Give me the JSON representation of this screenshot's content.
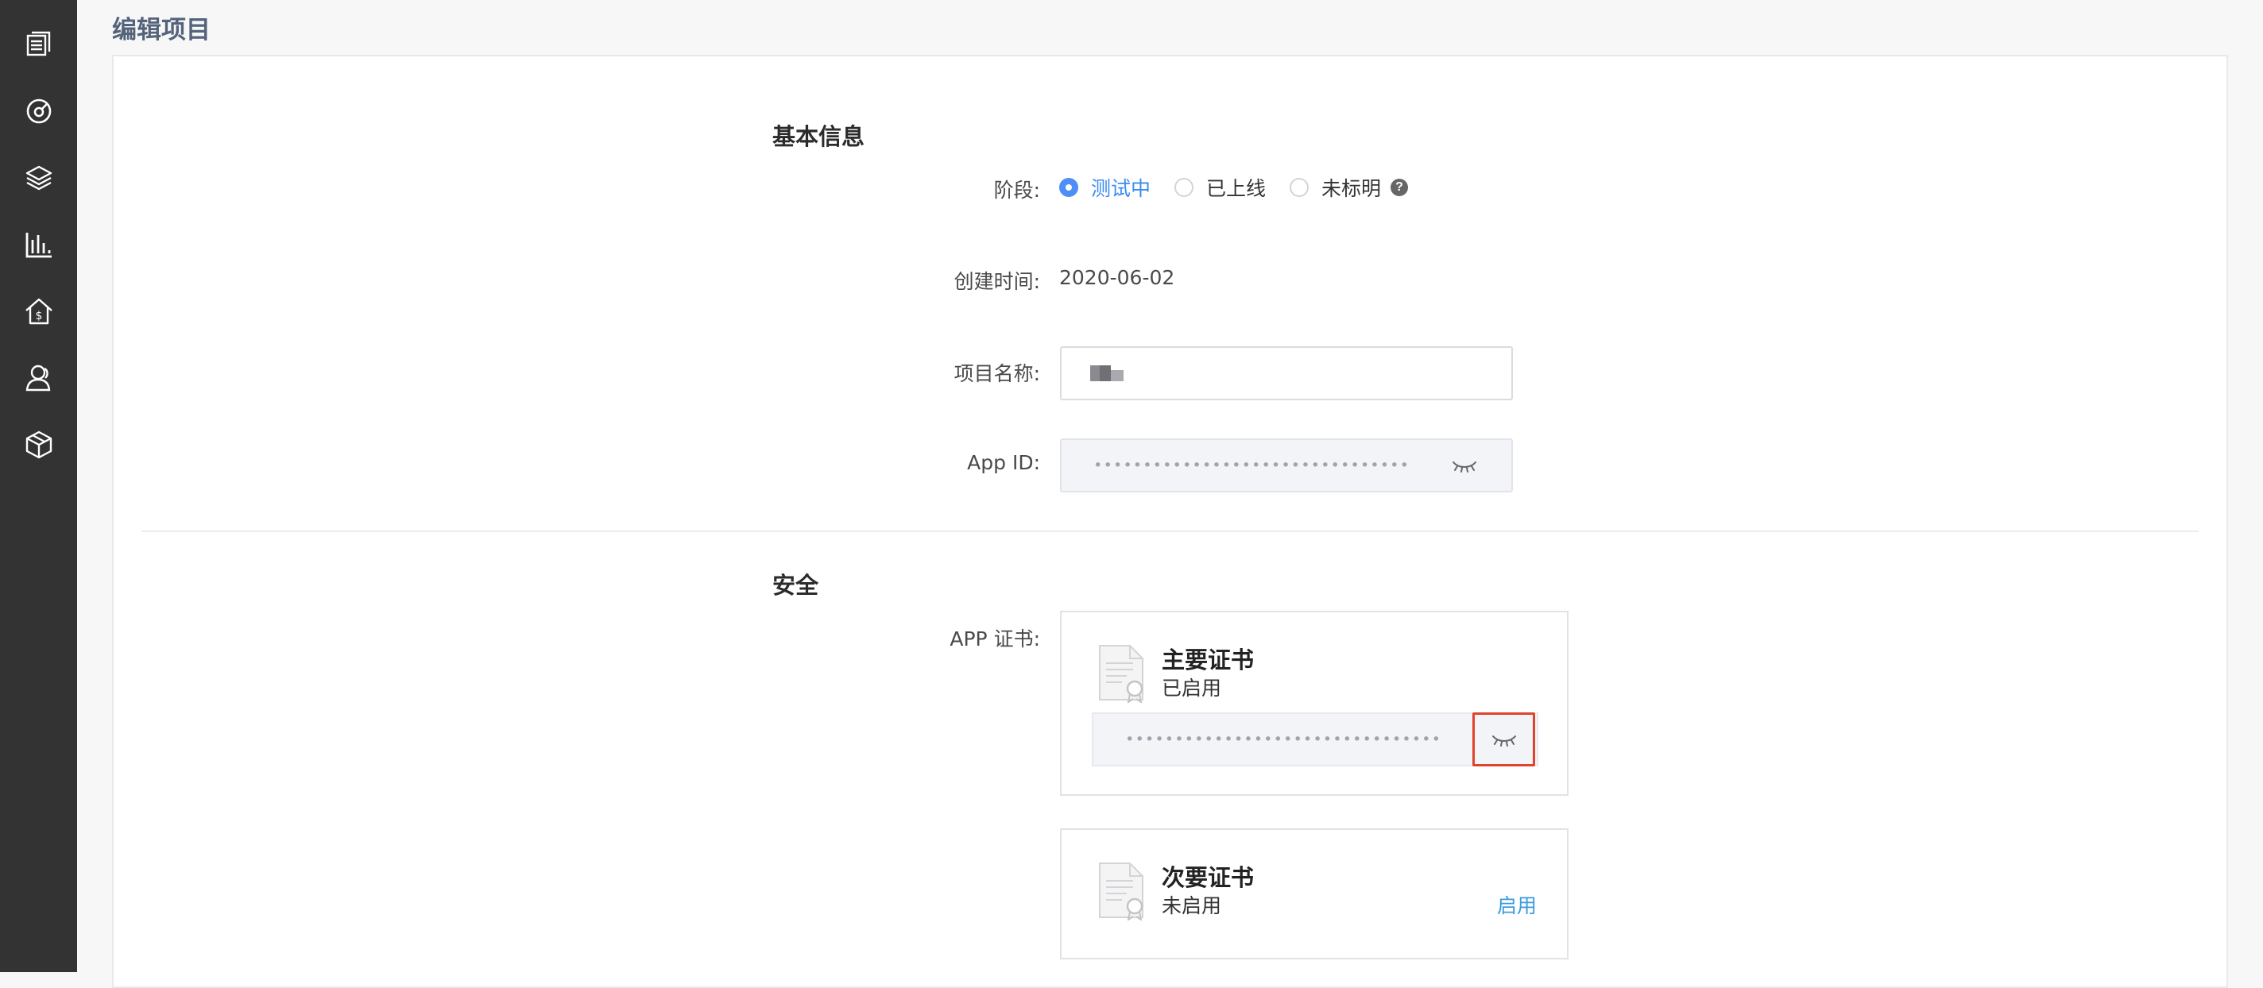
{
  "page": {
    "title": "编辑项目"
  },
  "sidebar": {
    "icons": [
      "documents-icon",
      "dashboard-icon",
      "layers-icon",
      "bar-chart-icon",
      "billing-icon",
      "user-icon",
      "package-icon"
    ]
  },
  "basic": {
    "title": "基本信息",
    "stage": {
      "label": "阶段:",
      "options": [
        {
          "label": "测试中",
          "selected": true
        },
        {
          "label": "已上线",
          "selected": false
        },
        {
          "label": "未标明",
          "selected": false
        }
      ],
      "help": "?"
    },
    "created": {
      "label": "创建时间:",
      "value": "2020-06-02"
    },
    "name": {
      "label": "项目名称:"
    },
    "appid": {
      "label": "App ID:",
      "masked": "••••••••••••••••••••••••••••••••"
    }
  },
  "security": {
    "title": "安全",
    "cert_label": "APP 证书:",
    "primary": {
      "title": "主要证书",
      "status": "已启用",
      "masked": "••••••••••••••••••••••••••••••••"
    },
    "secondary": {
      "title": "次要证书",
      "status": "未启用",
      "action": "启用"
    }
  },
  "colors": {
    "accent": "#3c8cf0",
    "link": "#3b9be0",
    "highlight": "#e0432b",
    "sidebar": "#333333"
  }
}
